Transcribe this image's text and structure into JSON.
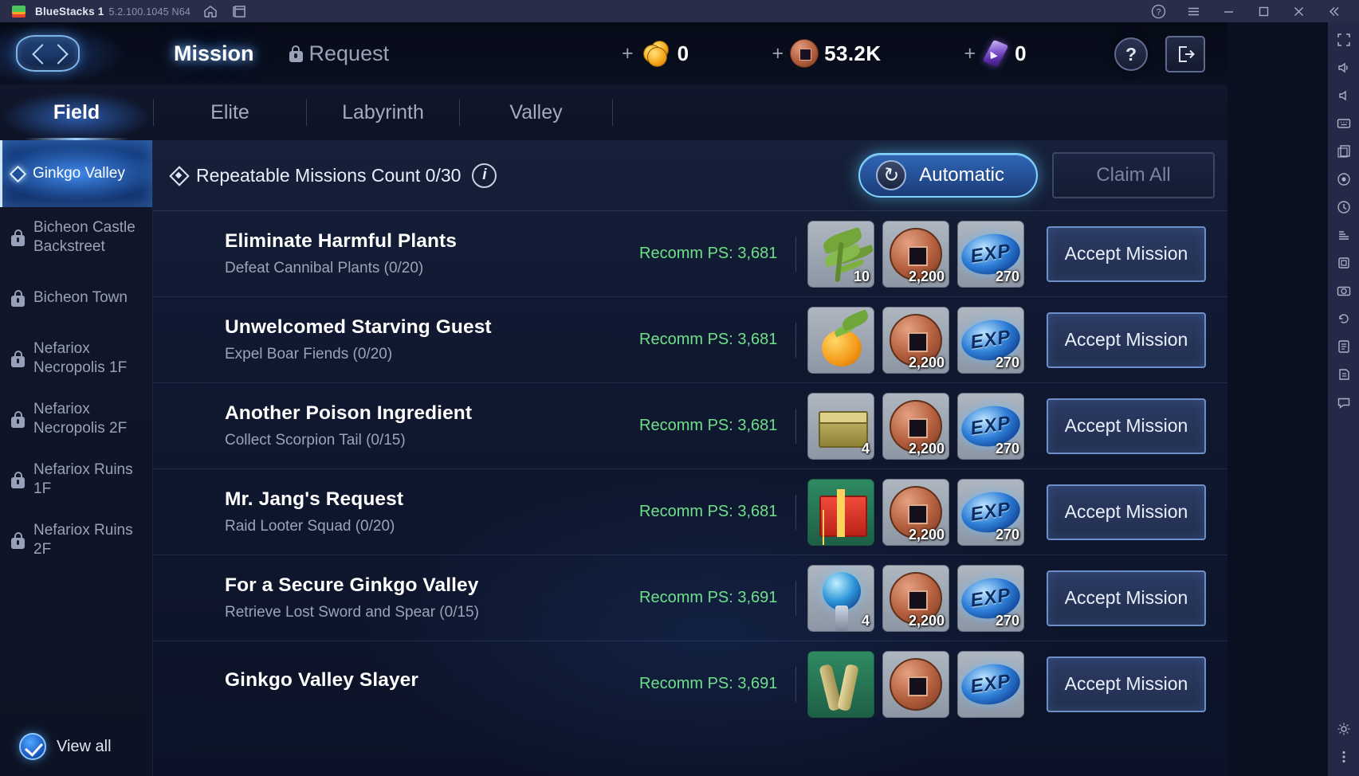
{
  "titlebar": {
    "app_name": "BlueStacks 1",
    "version": "5.2.100.1045 N64",
    "icons": [
      "home-icon",
      "multi-instance-icon"
    ],
    "controls": [
      "help-icon",
      "menu-icon",
      "minimize-icon",
      "maximize-icon",
      "close-icon",
      "collapse-icon"
    ]
  },
  "header": {
    "tabs": [
      {
        "label": "Mission",
        "active": true,
        "locked": false
      },
      {
        "label": "Request",
        "active": false,
        "locked": true
      }
    ],
    "currencies": [
      {
        "icon": "gold-coin-icon",
        "value": "0"
      },
      {
        "icon": "bronze-coin-icon",
        "value": "53.2K"
      },
      {
        "icon": "purple-crystal-icon",
        "value": "0"
      }
    ],
    "help_label": "?",
    "exit_label": "exit-icon"
  },
  "categories": [
    {
      "label": "Field",
      "active": true
    },
    {
      "label": "Elite",
      "active": false
    },
    {
      "label": "Labyrinth",
      "active": false
    },
    {
      "label": "Valley",
      "active": false
    }
  ],
  "sidebar": {
    "items": [
      {
        "label": "Ginkgo Valley",
        "locked": false,
        "active": true
      },
      {
        "label": "Bicheon Castle Backstreet",
        "locked": true,
        "active": false
      },
      {
        "label": "Bicheon Town",
        "locked": true,
        "active": false
      },
      {
        "label": "Nefariox Necropolis 1F",
        "locked": true,
        "active": false
      },
      {
        "label": "Nefariox Necropolis 2F",
        "locked": true,
        "active": false
      },
      {
        "label": "Nefariox Ruins 1F",
        "locked": true,
        "active": false
      },
      {
        "label": "Nefariox Ruins 2F",
        "locked": true,
        "active": false
      }
    ],
    "view_all_label": "View all"
  },
  "content": {
    "repeatable_label": "Repeatable Missions Count 0/30",
    "info_label": "i",
    "automatic_label": "Automatic",
    "claim_all_label": "Claim All",
    "accept_label": "Accept Mission",
    "missions": [
      {
        "title": "Eliminate Harmful Plants",
        "objective": "Defeat Cannibal Plants (0/20)",
        "recomm_ps": "Recomm PS: 3,681",
        "rewards": [
          {
            "art": "plant",
            "qty": "10",
            "green": false
          },
          {
            "art": "coin",
            "qty": "2,200",
            "green": false
          },
          {
            "art": "exp",
            "qty": "270",
            "green": false
          }
        ],
        "accept": "Accept Mission"
      },
      {
        "title": "Unwelcomed Starving Guest",
        "objective": "Expel Boar Fiends (0/20)",
        "recomm_ps": "Recomm PS: 3,681",
        "rewards": [
          {
            "art": "fruit",
            "qty": "",
            "green": false
          },
          {
            "art": "coin",
            "qty": "2,200",
            "green": false
          },
          {
            "art": "exp",
            "qty": "270",
            "green": false
          }
        ],
        "accept": "Accept Mission"
      },
      {
        "title": "Another Poison Ingredient",
        "objective": "Collect Scorpion Tail (0/15)",
        "recomm_ps": "Recomm PS: 3,681",
        "rewards": [
          {
            "art": "box",
            "qty": "4",
            "green": false
          },
          {
            "art": "coin",
            "qty": "2,200",
            "green": false
          },
          {
            "art": "exp",
            "qty": "270",
            "green": false
          }
        ],
        "accept": "Accept Mission"
      },
      {
        "title": "Mr. Jang's Request",
        "objective": "Raid Looter Squad (0/20)",
        "recomm_ps": "Recomm PS: 3,681",
        "rewards": [
          {
            "art": "gift",
            "qty": "",
            "green": true
          },
          {
            "art": "coin",
            "qty": "2,200",
            "green": false
          },
          {
            "art": "exp",
            "qty": "270",
            "green": false
          }
        ],
        "accept": "Accept Mission"
      },
      {
        "title": "For a Secure Ginkgo Valley",
        "objective": "Retrieve Lost Sword and Spear (0/15)",
        "recomm_ps": "Recomm PS: 3,691",
        "rewards": [
          {
            "art": "orb",
            "qty": "4",
            "green": false
          },
          {
            "art": "coin",
            "qty": "2,200",
            "green": false
          },
          {
            "art": "exp",
            "qty": "270",
            "green": false
          }
        ],
        "accept": "Accept Mission"
      },
      {
        "title": "Ginkgo Valley Slayer",
        "objective": "",
        "recomm_ps": "Recomm PS: 3,691",
        "rewards": [
          {
            "art": "scroll",
            "qty": "",
            "green": true
          },
          {
            "art": "coin",
            "qty": "",
            "green": false
          },
          {
            "art": "exp",
            "qty": "",
            "green": false
          }
        ],
        "accept": "Accept Mission"
      }
    ]
  },
  "right_toolbar": {
    "icons": [
      "fullscreen-icon",
      "volume-icon",
      "volume-down-icon",
      "keymapping-icon",
      "screenshot-icon",
      "record-icon",
      "clock-icon",
      "eco-mode-icon",
      "multi-instance-icon",
      "macro-icon",
      "rotate-icon",
      "trim-icon",
      "script-icon",
      "chat-icon"
    ],
    "bottom_icons": [
      "settings-icon",
      "more-icon"
    ]
  },
  "colors": {
    "accent_blue": "#7fd4ff",
    "green_text": "#6ee08a",
    "panel_bg": "#101931",
    "titlebar_bg": "#2a2d4a"
  }
}
